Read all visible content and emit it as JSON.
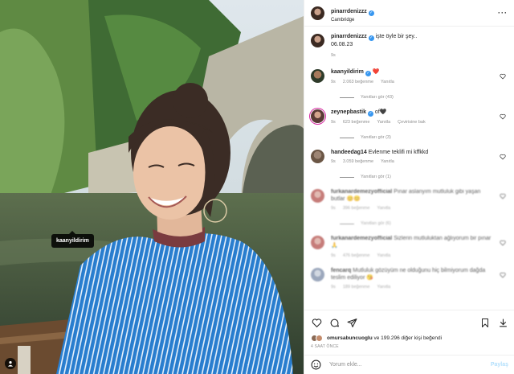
{
  "photo": {
    "tag_label": "kaanyildirim",
    "icons": [
      "user-tag-icon"
    ]
  },
  "post_header": {
    "username": "pinarrdenizzz",
    "location": "Cambridge",
    "more_icon": "more-dots-icon"
  },
  "caption": {
    "username": "pinarrdenizzz",
    "text": "işte öyle bir şey..",
    "date": "06.08.23",
    "time": "9s"
  },
  "comments": [
    {
      "username": "kaanyildirim",
      "text": "",
      "time": "9s",
      "likes": "2.063 beğenme",
      "reply": "Yanıtla",
      "translate": "",
      "replies": "Yanıtları gör (43)",
      "emoji": "❤️"
    },
    {
      "username": "zeynepbastik",
      "text": "of🖤",
      "time": "9s",
      "likes": "623 beğenme",
      "reply": "Yanıtla",
      "translate": "Çevirisine bak",
      "replies": "Yanıtları gör (3)"
    },
    {
      "username": "handeedag14",
      "text": "Evlenme teklifi mi kffkkd",
      "time": "9s",
      "likes": "3.059 beğenme",
      "reply": "Yanıtla",
      "translate": "",
      "replies": "Yanıtları gör (1)"
    },
    {
      "username": "furkanardemezyofficial",
      "text": "Pınar aslanyım mutluluk gibi yaşan butlar 😊😊",
      "time": "9s",
      "likes": "396 beğenme",
      "reply": "Yanıtla",
      "translate": "",
      "replies": "Yanıtları gör (6)"
    },
    {
      "username": "furkanardemezyofficial",
      "text": "Sizlerin mutluluktan ağlıyorum bir pınar 🙏",
      "time": "9s",
      "likes": "476 beğenme",
      "reply": "Yanıtla",
      "translate": "",
      "replies": ""
    },
    {
      "username": "fencarq",
      "text": "Mutluluk gözüyüm ne olduğunu hiç bilmiyorum dağda teslim ediliyor 😘",
      "time": "9s",
      "likes": "189 beğenme",
      "reply": "Yanıtla",
      "translate": "",
      "replies": ""
    }
  ],
  "actions": {
    "icons": [
      "heart-icon",
      "comment-icon",
      "share-icon",
      "bookmark-icon",
      "download-icon"
    ],
    "likes_user": "omursabuncuoglu",
    "likes_rest": "ve 199.296 diğer kişi beğendi",
    "ago": "4 SAAT ÖNCE"
  },
  "add_comment": {
    "placeholder": "Yorum ekle...",
    "post_label": "Paylaş",
    "emoji_icon": "smile-icon"
  }
}
